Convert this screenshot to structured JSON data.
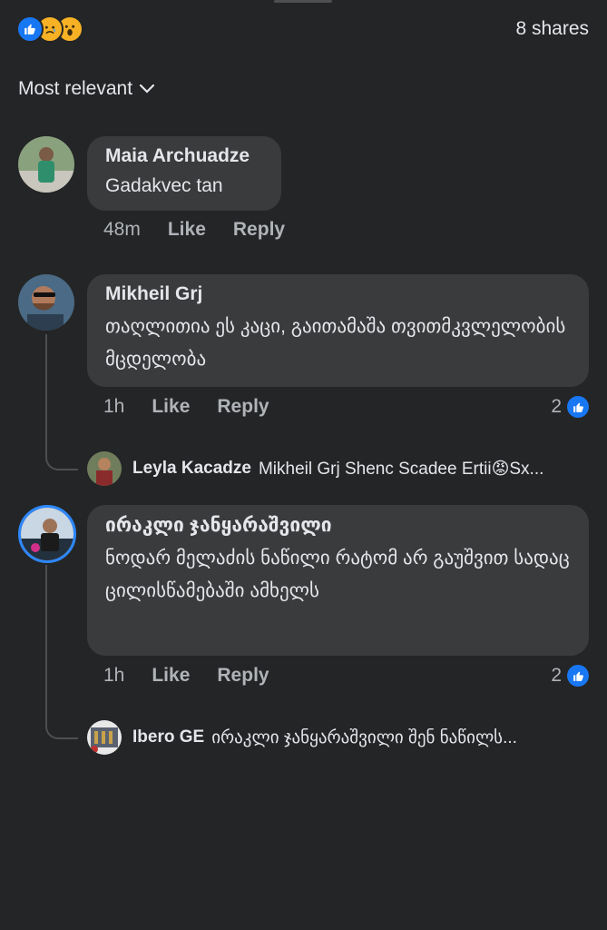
{
  "header": {
    "reactions": [
      "like-icon",
      "sad-icon",
      "wow-icon"
    ],
    "shares": "8 shares"
  },
  "sort": {
    "label": "Most relevant"
  },
  "comments": [
    {
      "author": "Maia Archuadze",
      "text": "Gadakvec tan",
      "time": "48m",
      "like": "Like",
      "reply": "Reply"
    },
    {
      "author": "Mikheil Grj",
      "text": "თაღლითია ეს კაცი, გაითამაშა თვითმკვლელობის მცდელობა",
      "time": "1h",
      "like": "Like",
      "reply": "Reply",
      "likes": "2",
      "reply_preview": {
        "author": "Leyla  Kacadze",
        "text": "Mikheil Grj Shenc Scadee Ertii😡Sx..."
      }
    },
    {
      "author": "ირაკლი ჯანყარაშვილი",
      "text": "ნოდარ მელაძის ნაწილი რატომ არ გაუშვით სადაც ცილისწამებაში ამხელს",
      "time": "1h",
      "like": "Like",
      "reply": "Reply",
      "likes": "2",
      "reply_preview": {
        "author": "Ibero GE",
        "text": "ირაკლი ჯანყარაშვილი შენ ნაწილს..."
      }
    }
  ],
  "colors": {
    "background": "#242526",
    "bubble": "#3a3b3c",
    "accent": "#1877f2",
    "muted": "#b0b3b8"
  }
}
